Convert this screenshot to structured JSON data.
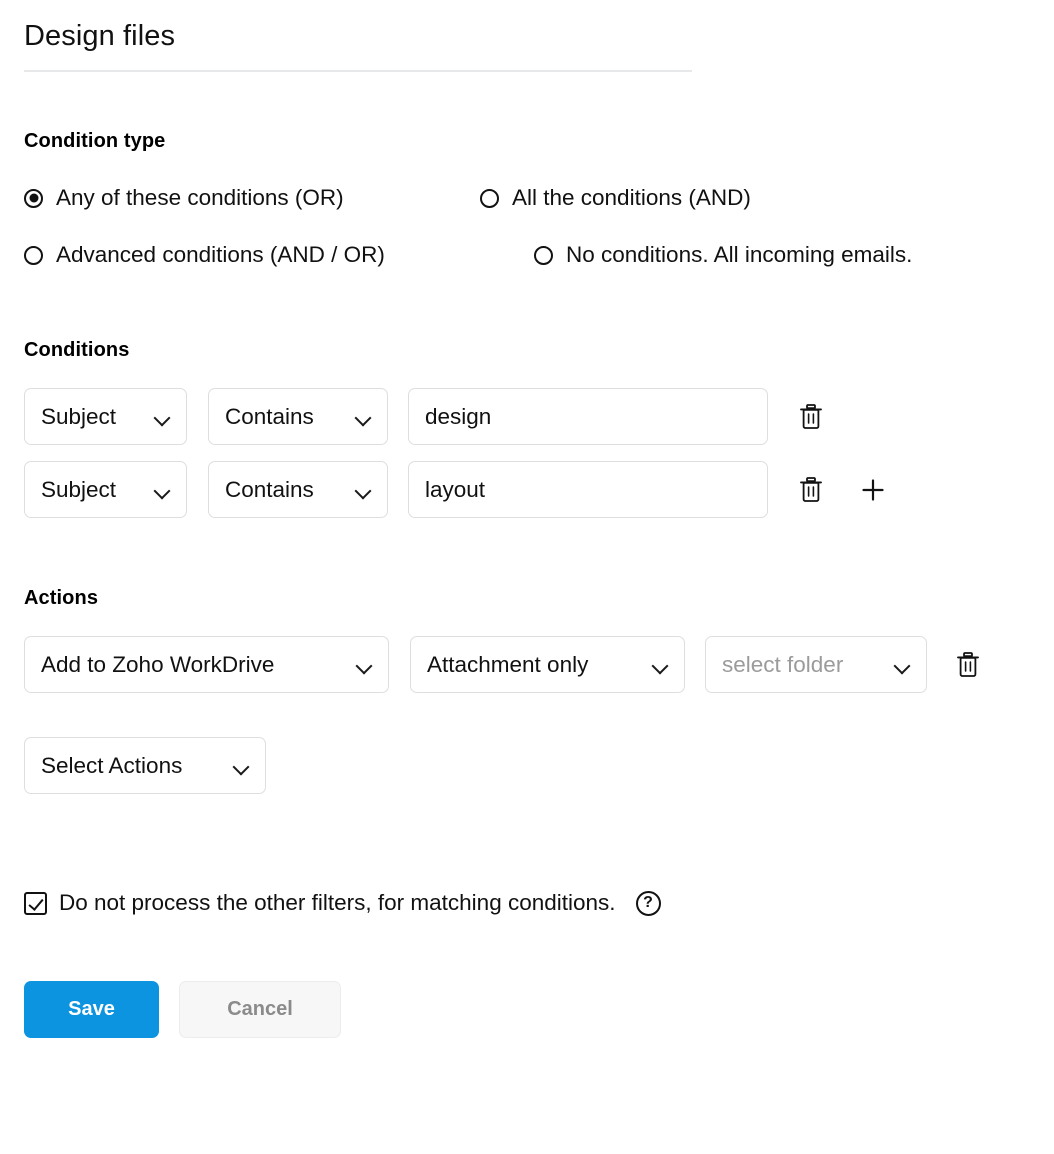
{
  "header": {
    "title": "Design files"
  },
  "condition_type": {
    "heading": "Condition type",
    "options": [
      {
        "label": "Any of these conditions (OR)",
        "selected": true
      },
      {
        "label": "All the conditions (AND)",
        "selected": false
      },
      {
        "label": "Advanced conditions (AND / OR)",
        "selected": false
      },
      {
        "label": "No conditions. All incoming emails.",
        "selected": false
      }
    ]
  },
  "conditions": {
    "heading": "Conditions",
    "rows": [
      {
        "field": "Subject",
        "operator": "Contains",
        "value": "design",
        "delete_icon": "trash-icon"
      },
      {
        "field": "Subject",
        "operator": "Contains",
        "value": "layout",
        "delete_icon": "trash-icon",
        "add_icon": "plus-icon"
      }
    ]
  },
  "actions": {
    "heading": "Actions",
    "rows": [
      {
        "action": "Add to Zoho WorkDrive",
        "scope": "Attachment only",
        "target_placeholder": "select folder",
        "delete_icon": "trash-icon"
      }
    ],
    "add_action_label": "Select Actions"
  },
  "options": {
    "stop_processing": {
      "label": "Do not process the other filters, for matching conditions.",
      "checked": true,
      "help_icon": "help-icon",
      "help_glyph": "?"
    }
  },
  "footer": {
    "save_label": "Save",
    "cancel_label": "Cancel"
  },
  "colors": {
    "primary": "#0d94e0",
    "border": "#dedede",
    "divider": "#e6e8e9",
    "placeholder": "#9b9b9b",
    "cancel_text": "#8b8b8b"
  }
}
